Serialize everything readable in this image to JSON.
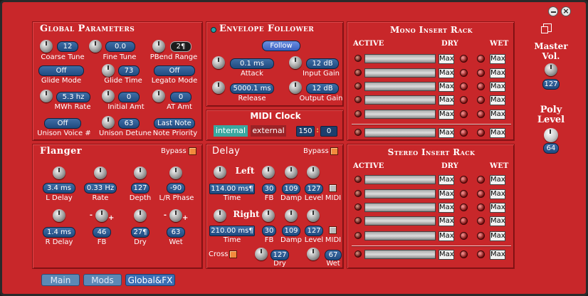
{
  "window": {
    "buttons": [
      "minimize",
      "close"
    ]
  },
  "global": {
    "title": "Global Parameters",
    "coarse_tune": "12",
    "coarse_tune_label": "Coarse Tune",
    "fine_tune": "0.0",
    "fine_tune_label": "Fine Tune",
    "pbend": "2¶",
    "pbend_label": "PBend Range",
    "glide_mode": "Off",
    "glide_mode_label": "Glide Mode",
    "glide_time": "73",
    "glide_time_label": "Glide Time",
    "legato": "Off",
    "legato_label": "Legato Mode",
    "mwh_rate": "5.3 hz",
    "mwh_rate_label": "MWh Rate",
    "initial_amt": "0",
    "initial_amt_label": "Initial Amt",
    "at_amt": "0",
    "at_amt_label": "AT Amt",
    "unison_voice": "Off",
    "unison_voice_label": "Unison Voice #",
    "unison_detune": "63",
    "unison_detune_label": "Unison Detune",
    "note_priority": "Last Note",
    "note_priority_label": "Note Priority"
  },
  "envelope": {
    "title": "Envelope Follower",
    "follow": "Follow",
    "attack": "0.1 ms",
    "attack_label": "Attack",
    "input_gain": "12 dB",
    "input_gain_label": "Input Gain",
    "release": "5000.1 ms",
    "release_label": "Release",
    "output_gain": "12 dB",
    "output_gain_label": "Output Gain"
  },
  "midi_clock": {
    "title": "MIDI Clock",
    "internal": "internal",
    "external": "external",
    "bpm": "150",
    "bpm_sep": ":",
    "frac": "0"
  },
  "flanger": {
    "title": "Flanger",
    "bypass": "Bypass",
    "l_delay": "3.4 ms",
    "l_delay_label": "L Delay",
    "rate": "0.33 Hz",
    "rate_label": "Rate",
    "depth": "127",
    "depth_label": "Depth",
    "lr_phase": "-90",
    "lr_phase_label": "L/R Phase",
    "r_delay": "1.4 ms",
    "r_delay_label": "R Delay",
    "fb": "46",
    "fb_label": "FB",
    "fb_minus": "-",
    "fb_plus": "+",
    "dry": "27¶",
    "dry_label": "Dry",
    "wet": "63",
    "wet_label": "Wet",
    "wet_minus": "-",
    "wet_plus": "+"
  },
  "delay": {
    "title": "Delay",
    "bypass": "Bypass",
    "left_label": "Left",
    "left_time": "114.00 ms¶",
    "left_fb": "30",
    "left_damp": "109",
    "left_level": "127",
    "right_label": "Right",
    "right_time": "210.00 ms¶",
    "right_fb": "30",
    "right_damp": "109",
    "right_level": "127",
    "time_label": "Time",
    "fb_label": "FB",
    "damp_label": "Damp",
    "level_label": "Level",
    "midi_label": "MIDI",
    "cross_label": "Cross",
    "dry": "127",
    "dry_label": "Dry",
    "wet": "67",
    "wet_label": "Wet"
  },
  "mono_rack": {
    "title": "Mono Insert Rack",
    "active": "ACTIVE",
    "dry": "DRY",
    "wet": "WET",
    "max": "Max"
  },
  "stereo_rack": {
    "title": "Stereo Insert Rack",
    "active": "ACTIVE",
    "dry": "DRY",
    "wet": "WET",
    "max": "Max"
  },
  "master": {
    "label1": "Master",
    "label2": "Vol.",
    "value": "127"
  },
  "poly": {
    "label1": "Poly",
    "label2": "Level",
    "value": "64"
  },
  "tabs": [
    "Main",
    "Mods",
    "Global&FX"
  ],
  "colors": {
    "panel": "#c8272a",
    "display": "#2a5a94",
    "bypass_check": "#f28a3c",
    "active_tab": "#3a6fb5"
  }
}
